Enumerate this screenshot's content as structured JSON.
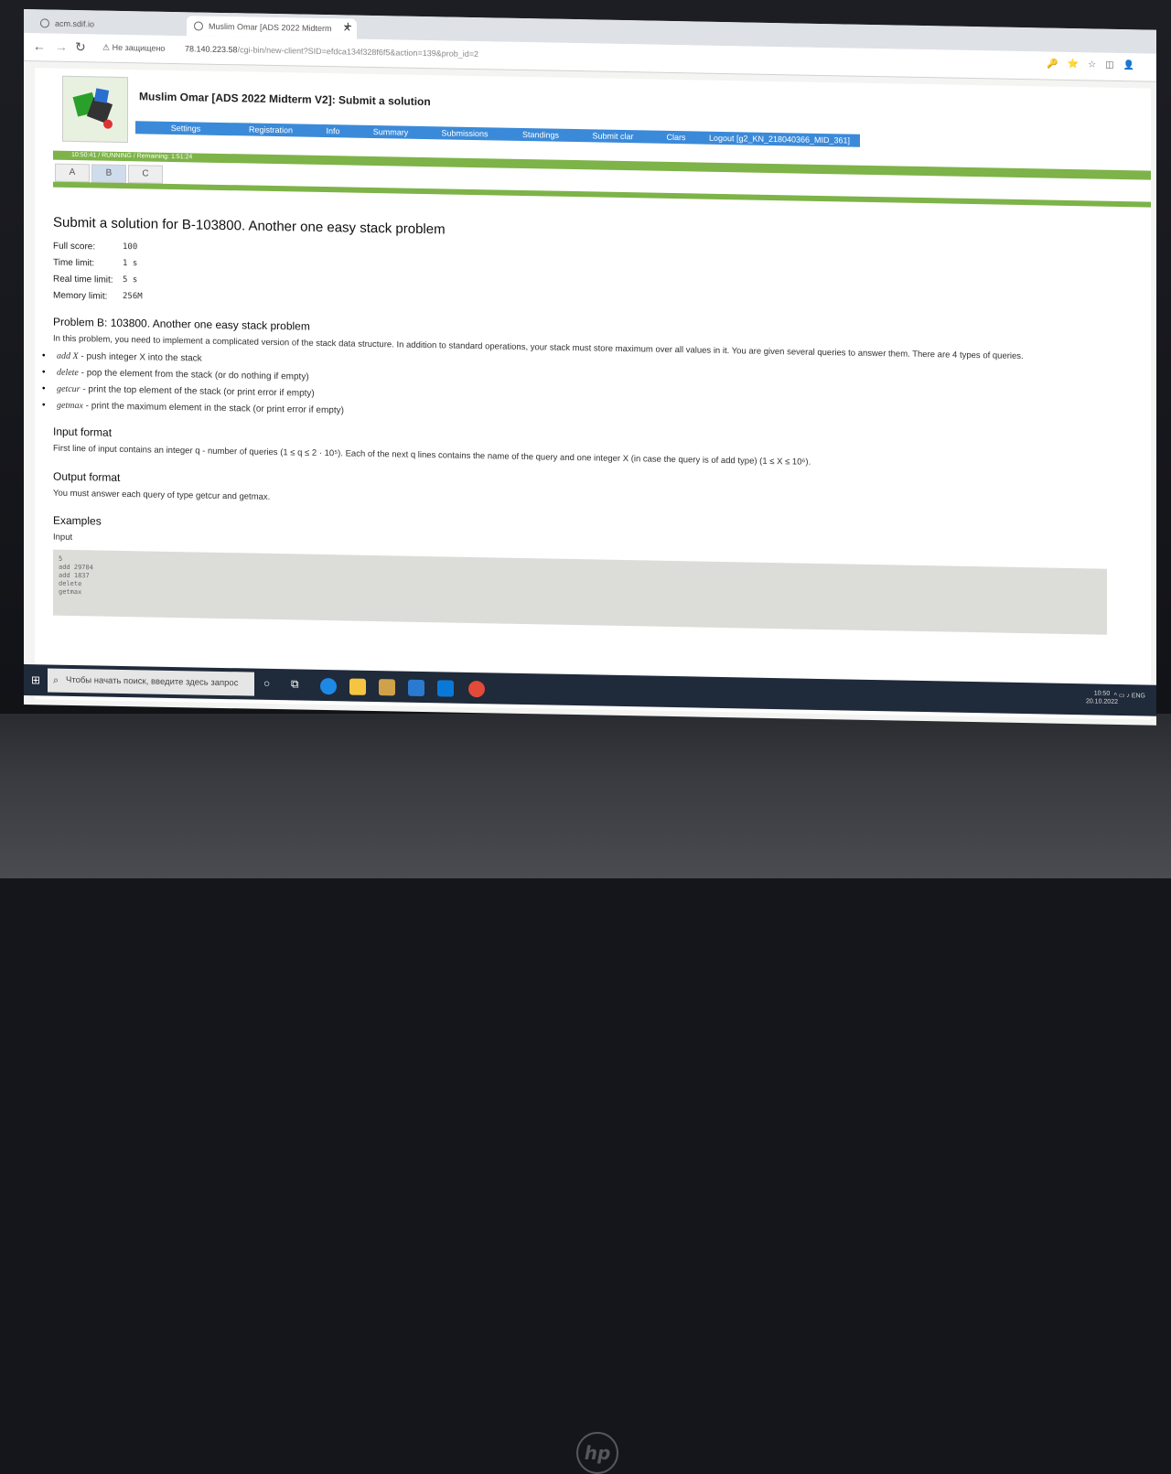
{
  "browser": {
    "tab1_title": "acm.sdif.io",
    "tab2_title": "Muslim Omar [ADS 2022 Midterm",
    "security_label": "Не защищено",
    "url_host": "78.140.223.58",
    "url_path": "/cgi-bin/new-client?SID=efdca134f328f6f5&action=139&prob_id=2"
  },
  "header": {
    "title": "Muslim Omar [ADS 2022 Midterm V2]: Submit a solution",
    "menu": [
      "Settings",
      "Registration",
      "Info",
      "Summary",
      "Submissions",
      "Standings",
      "Submit clar",
      "Clars",
      "Logout [g2_KN_218040366_MID_361]"
    ]
  },
  "status": {
    "time": "10:50:41",
    "state": "RUNNING",
    "remaining": "Remaining: 1:51:24"
  },
  "problem_tabs": [
    "A",
    "B",
    "C"
  ],
  "main": {
    "heading": "Submit a solution for B-103800. Another one easy stack problem",
    "full_score_label": "Full score:",
    "full_score": "100",
    "time_limit_label": "Time limit:",
    "time_limit": "1 s",
    "real_time_label": "Real time limit:",
    "real_time": "5 s",
    "memory_label": "Memory limit:",
    "memory": "256M",
    "problem_title": "Problem B: 103800. Another one easy stack problem",
    "intro": "In this problem, you need to implement a complicated version of the stack data structure. In addition to standard operations, your stack must store maximum over all values in it. You are given several queries to answer them. There are 4 types of queries.",
    "ops": [
      {
        "name": "add X",
        "desc": " - push integer X into the stack"
      },
      {
        "name": "delete",
        "desc": " - pop the element from the stack (or do nothing if empty)"
      },
      {
        "name": "getcur",
        "desc": " - print the top element of the stack (or print error if empty)"
      },
      {
        "name": "getmax",
        "desc": " - print the maximum element in the stack (or print error if empty)"
      }
    ],
    "input_format_title": "Input format",
    "input_format": "First line of input contains an integer q - number of queries (1 ≤ q ≤ 2 · 10⁵). Each of the next q lines contains the name of the query and one integer X (in case the query is of add type) (1 ≤ X ≤ 10⁶).",
    "output_format_title": "Output format",
    "output_format": "You must answer each query of type getcur and getmax.",
    "examples_title": "Examples",
    "input_label": "Input",
    "example_input": [
      "5",
      "add 29704",
      "add 1837",
      "delete",
      "getmax"
    ]
  },
  "taskbar": {
    "search_placeholder": "Чтобы начать поиск, введите здесь запрос",
    "lang": "ENG",
    "time": "10:50",
    "date": "20.10.2022"
  }
}
